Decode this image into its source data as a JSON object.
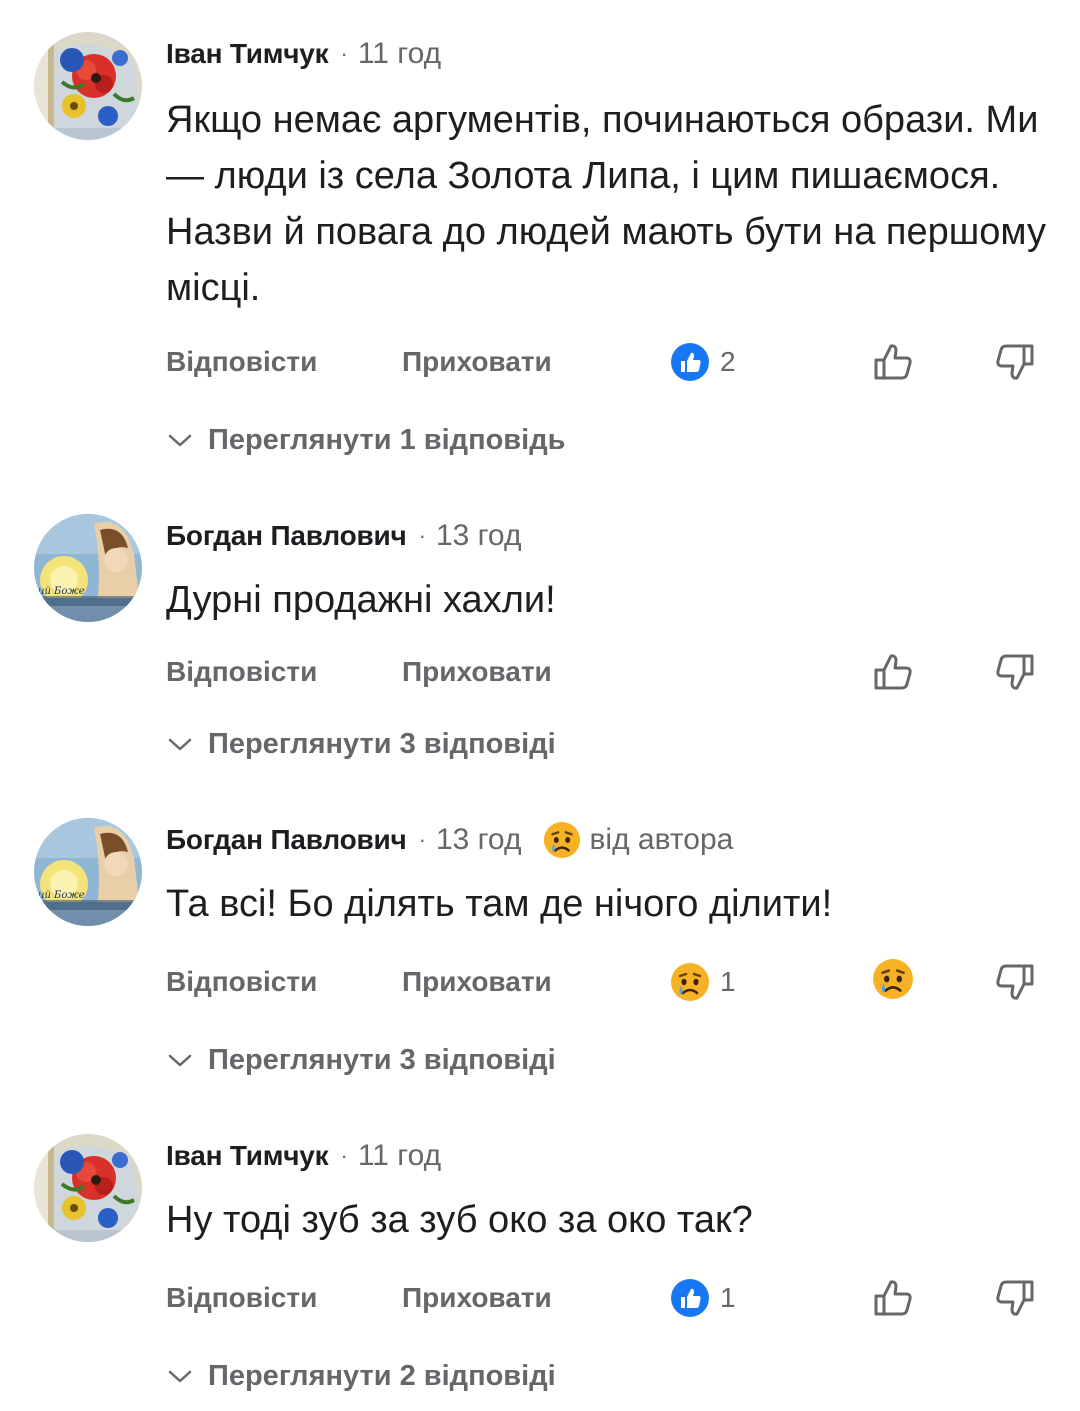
{
  "comments": [
    {
      "author": "Іван Тимчук",
      "time": "11 год",
      "text": "Якщо немає аргументів, починаються образи. Ми — люди із села Золота Липа, і цим пишаємося. Назви й повага до людей мають бути на першому місці.",
      "reply_label": "Відповісти",
      "hide_label": "Приховати",
      "reaction_icon": "like-icon",
      "reaction_count": "2",
      "replies_label": "Переглянути 1 відповідь"
    },
    {
      "author": "Богдан Павлович",
      "time": "13 год",
      "text": "Дурні продажні хахли!",
      "reply_label": "Відповісти",
      "hide_label": "Приховати",
      "replies_label": "Переглянути 3 відповіді"
    },
    {
      "author": "Богдан Павлович",
      "time": "13 год",
      "author_flag": "від автора",
      "text": "Та всі! Бо ділять там де нічого ділити!",
      "reply_label": "Відповісти",
      "hide_label": "Приховати",
      "reaction_icon": "sad-icon",
      "reaction_count": "1",
      "replies_label": "Переглянути 3 відповіді"
    },
    {
      "author": "Іван Тимчук",
      "time": "11 год",
      "text": "Ну тоді зуб за зуб око за око так?",
      "reply_label": "Відповісти",
      "hide_label": "Приховати",
      "reaction_icon": "like-icon",
      "reaction_count": "1",
      "replies_label": "Переглянути 2 відповіді"
    }
  ],
  "avatar_caption": "ий Боже",
  "colors": {
    "text": "#1c1e21",
    "secondary": "#65676b",
    "like_blue": "#1877f2",
    "sad_yellow": "#f7b125",
    "background": "#ffffff"
  }
}
